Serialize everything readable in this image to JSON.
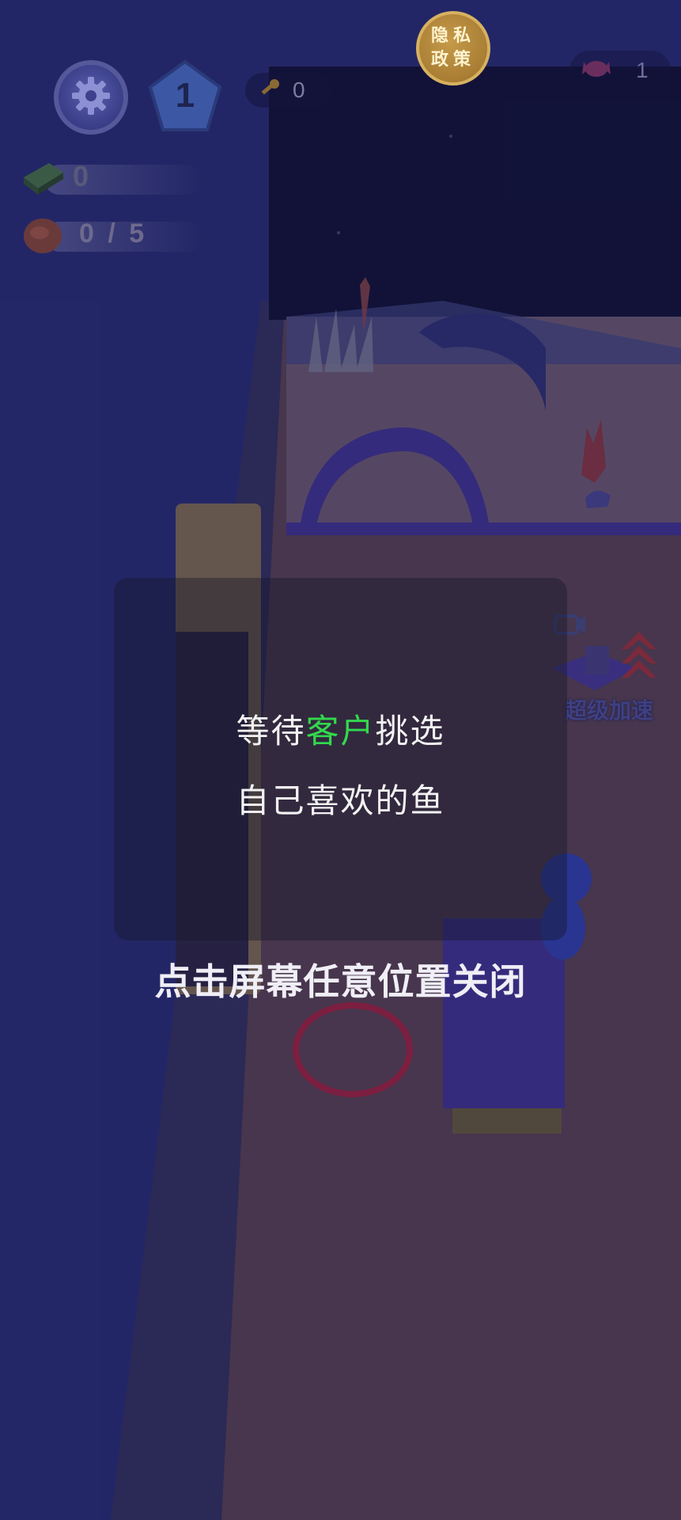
{
  "hud": {
    "settings_icon": "gear-icon",
    "level": "1",
    "key_count": "0",
    "privacy_label": "隐私政策",
    "gem_count": "1",
    "cash_count": "0",
    "fish_count": "0 / 5"
  },
  "booster": {
    "label": "超级加速",
    "icon": "video-ad-icon"
  },
  "tutorial": {
    "line1_pre": "等待",
    "line1_highlight": "客户",
    "line1_post": "挑选",
    "line2": "自己喜欢的鱼",
    "close_hint": "点击屏幕任意位置关闭"
  },
  "colors": {
    "highlight": "#33d94d",
    "background": "#262a6e",
    "floor": "#4e3b52",
    "privacy_gold": "#b08338"
  }
}
